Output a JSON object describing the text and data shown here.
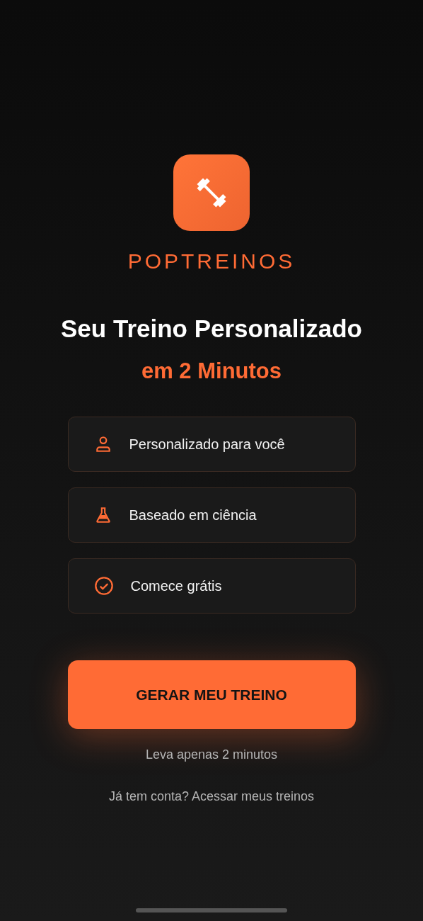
{
  "brand": {
    "name": "POPTREINOS"
  },
  "headline": "Seu Treino Personalizado",
  "subheadline": "em 2 Minutos",
  "features": [
    {
      "kind": "person",
      "label": "Personalizado para você"
    },
    {
      "kind": "flask",
      "label": "Baseado em ciência"
    },
    {
      "kind": "check",
      "label": "Comece grátis"
    }
  ],
  "cta": {
    "label": "GERAR MEU TREINO",
    "note": "Leva apenas 2 minutos"
  },
  "login_link": "Já tem conta? Acessar meus treinos"
}
